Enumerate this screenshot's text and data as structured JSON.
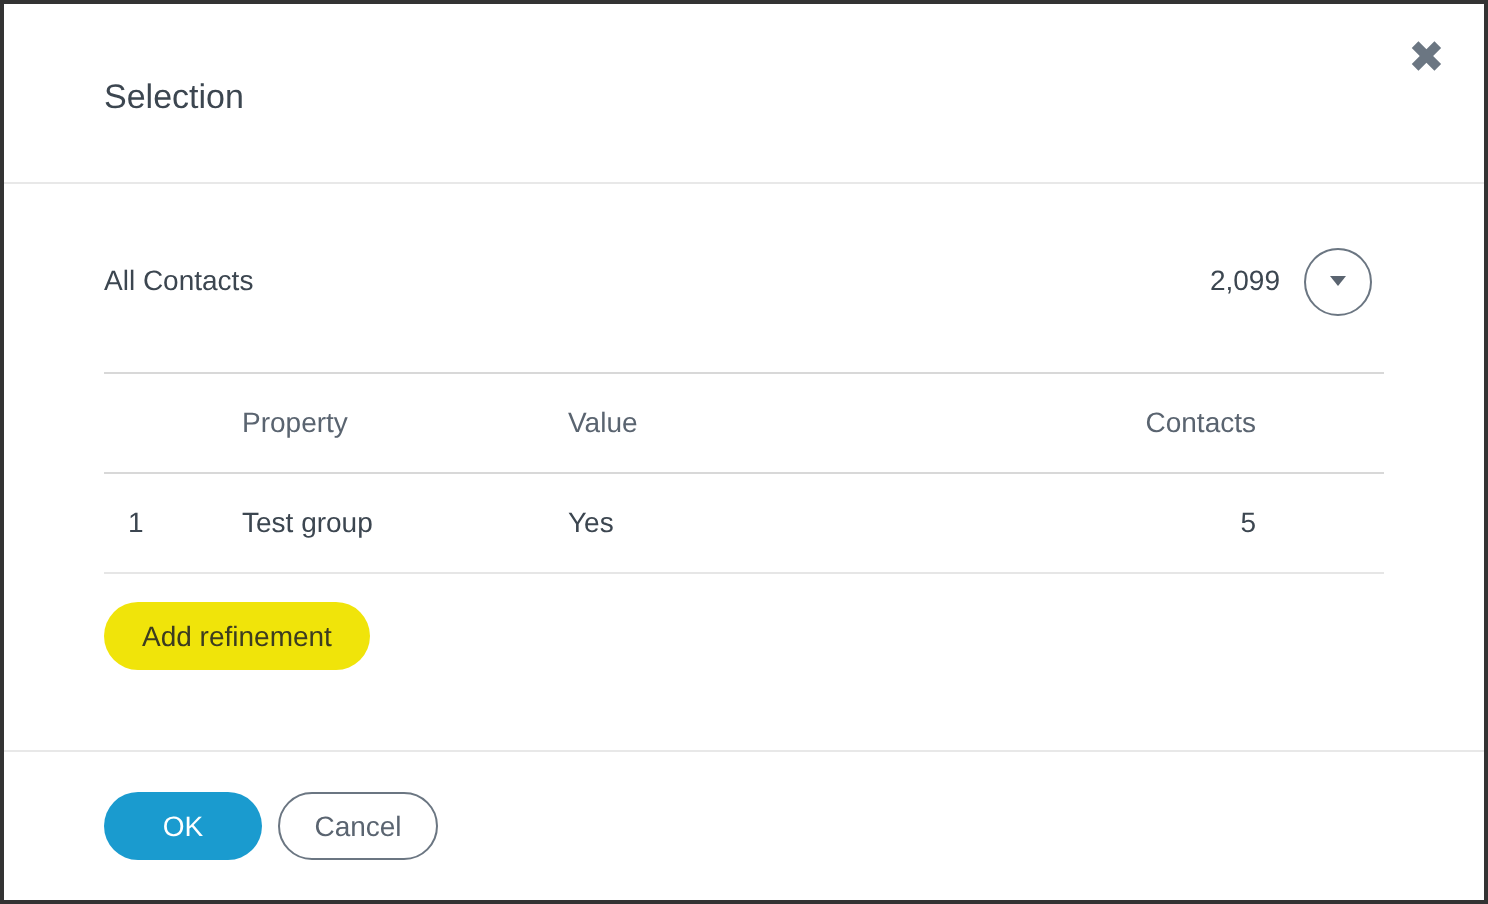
{
  "dialog": {
    "title": "Selection",
    "close_icon": "✖"
  },
  "base": {
    "label": "All Contacts",
    "count": "2,099"
  },
  "table": {
    "columns": [
      "",
      "Property",
      "Value",
      "Contacts"
    ],
    "rows": [
      [
        "1",
        "Test group",
        "Yes",
        "5"
      ]
    ]
  },
  "add_button": "Add refinement",
  "buttons": [
    {
      "label": "OK",
      "kind": "primary"
    },
    {
      "label": "Cancel",
      "kind": "secondary"
    }
  ]
}
